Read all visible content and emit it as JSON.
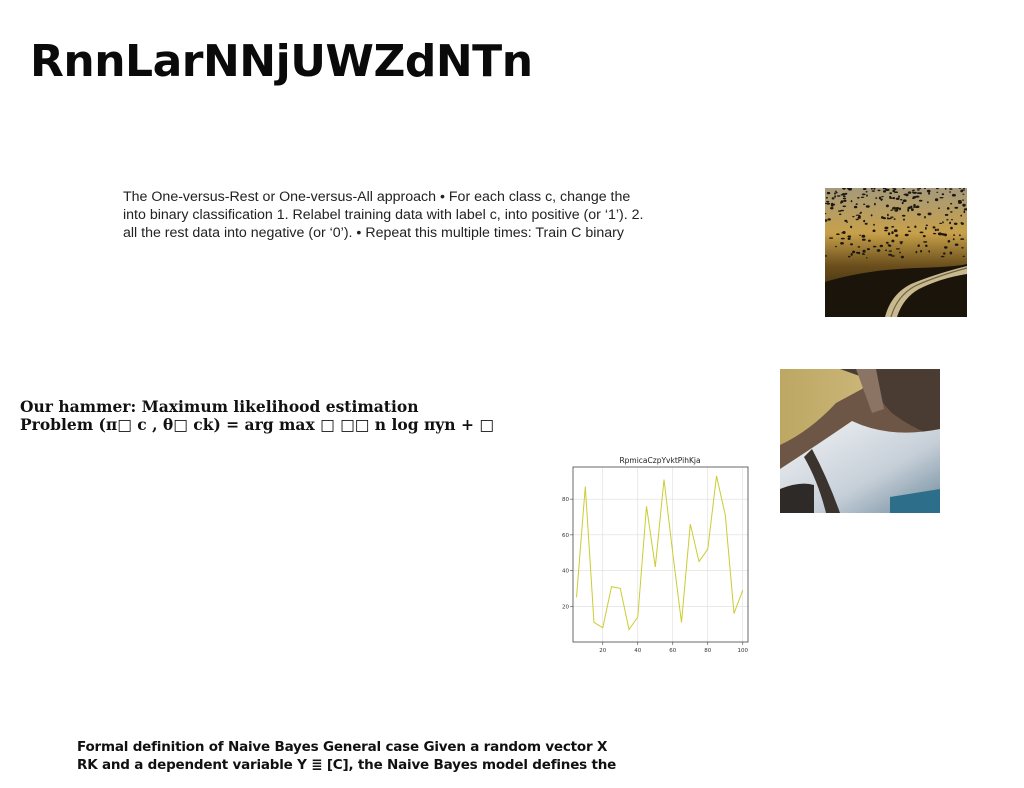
{
  "title": "RnnLarNNjUWZdNTn",
  "block1": {
    "lines": [
      "The One-versus-Rest or One-versus-All approach • For each class c, change the",
      "into binary classification 1. Relabel training data with label c, into positive (or ‘1’). 2.",
      "all the rest data into negative (or ‘0’). • Repeat this multiple times: Train C binary"
    ]
  },
  "block2": {
    "lines": [
      "Our hammer: Maximum likelihood estimation",
      "Problem (π□ c , θ□ ck) = arg max □ □□ n log πyn + □"
    ]
  },
  "block3": {
    "lines": [
      "Formal definition of Naive Bayes General case Given a random vector X",
      "RK and a dependent variable Y ≣ [C], the Naive Bayes model defines the"
    ]
  },
  "chart_data": {
    "type": "line",
    "title": "RpmicaCzpYvktPihKja",
    "xlabel": "",
    "ylabel": "",
    "xlim": [
      3,
      103
    ],
    "ylim": [
      0,
      98
    ],
    "x_ticks": [
      20,
      40,
      60,
      80,
      100
    ],
    "y_ticks": [
      20,
      40,
      60,
      80
    ],
    "grid": true,
    "line_color": "#cccc33",
    "x": [
      5,
      10,
      15,
      20,
      25,
      30,
      35,
      40,
      45,
      50,
      55,
      60,
      65,
      70,
      75,
      80,
      85,
      90,
      95,
      100
    ],
    "y": [
      25,
      87,
      11,
      8,
      31,
      30,
      7,
      14,
      76,
      42,
      91,
      50,
      11,
      66,
      45,
      52,
      93,
      71,
      16,
      29
    ]
  }
}
